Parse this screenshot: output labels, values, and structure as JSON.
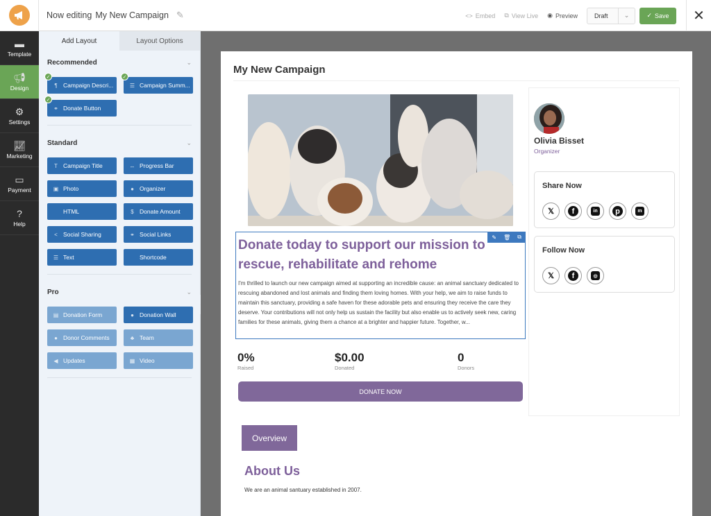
{
  "header": {
    "editing_label": "Now editing",
    "campaign_name": "My New Campaign",
    "actions": {
      "embed": "Embed",
      "view_live": "View Live",
      "preview": "Preview"
    },
    "status_select": "Draft",
    "save_label": "Save"
  },
  "left_nav": [
    {
      "label": "Template",
      "icon": "template-icon"
    },
    {
      "label": "Design",
      "icon": "megaphone-icon",
      "active": true
    },
    {
      "label": "Settings",
      "icon": "gears-icon"
    },
    {
      "label": "Marketing",
      "icon": "chart-icon"
    },
    {
      "label": "Payment",
      "icon": "card-icon"
    },
    {
      "label": "Help",
      "icon": "help-icon"
    }
  ],
  "panel": {
    "tabs": [
      "Add Layout",
      "Layout Options"
    ],
    "sections": [
      {
        "title": "Recommended",
        "blocks": [
          {
            "label": "Campaign Descri...",
            "icon": "¶",
            "added": true
          },
          {
            "label": "Campaign Summ...",
            "icon": "☰",
            "added": true
          },
          {
            "label": "Donate Button",
            "icon": "⚭",
            "added": true
          }
        ]
      },
      {
        "title": "Standard",
        "blocks": [
          {
            "label": "Campaign Title",
            "icon": "T"
          },
          {
            "label": "Progress Bar",
            "icon": "↔"
          },
          {
            "label": "Photo",
            "icon": "▣"
          },
          {
            "label": "Organizer",
            "icon": "●"
          },
          {
            "label": "HTML",
            "icon": "</>"
          },
          {
            "label": "Donate Amount",
            "icon": "$"
          },
          {
            "label": "Social Sharing",
            "icon": "<"
          },
          {
            "label": "Social Links",
            "icon": "⚭"
          },
          {
            "label": "Text",
            "icon": "☰"
          },
          {
            "label": "Shortcode",
            "icon": "</>"
          }
        ]
      },
      {
        "title": "Pro",
        "blocks": [
          {
            "label": "Donation Form",
            "icon": "▤",
            "pro": true
          },
          {
            "label": "Donation Wall",
            "icon": "●"
          },
          {
            "label": "Donor Comments",
            "icon": "●",
            "pro": true
          },
          {
            "label": "Team",
            "icon": "♣",
            "pro": true
          },
          {
            "label": "Updates",
            "icon": "◀",
            "pro": true
          },
          {
            "label": "Video",
            "icon": "▦",
            "pro": true
          }
        ]
      }
    ]
  },
  "page": {
    "title": "My New Campaign",
    "headline": "Donate today to support our mission to rescue, rehabilitate and rehome",
    "description": "I'm thrilled to launch our new campaign aimed at supporting an incredible cause: an animal sanctuary dedicated to rescuing abandoned and lost animals and finding them loving homes. With your help, we aim to raise funds to maintain this sanctuary, providing a safe haven for these adorable pets and ensuring they receive the care they deserve. Your contributions will not only help us sustain the facility but also enable us to actively seek new, caring families for these animals, giving them a chance at a brighter and happier future. Together, w...",
    "stats": [
      {
        "value": "0%",
        "label": "Raised"
      },
      {
        "value": "$0.00",
        "label": "Donated"
      },
      {
        "value": "0",
        "label": "Donors"
      }
    ],
    "donate_label": "DONATE NOW",
    "organizer": {
      "name": "Olivia Bisset",
      "role": "Organizer"
    },
    "share": {
      "title": "Share Now",
      "icons": [
        "x-icon",
        "facebook-icon",
        "linkedin-icon",
        "pinterest-icon",
        "mastodon-icon"
      ]
    },
    "follow": {
      "title": "Follow Now",
      "icons": [
        "x-icon",
        "facebook-icon",
        "instagram-icon"
      ]
    },
    "tab_label": "Overview",
    "about_title": "About Us",
    "about_text": "We are an animal santuary established in 2007."
  },
  "colors": {
    "accent_green": "#6aa556",
    "block_blue": "#2e6eb1",
    "brand_purple": "#80689a",
    "logo_orange": "#eea24a"
  }
}
